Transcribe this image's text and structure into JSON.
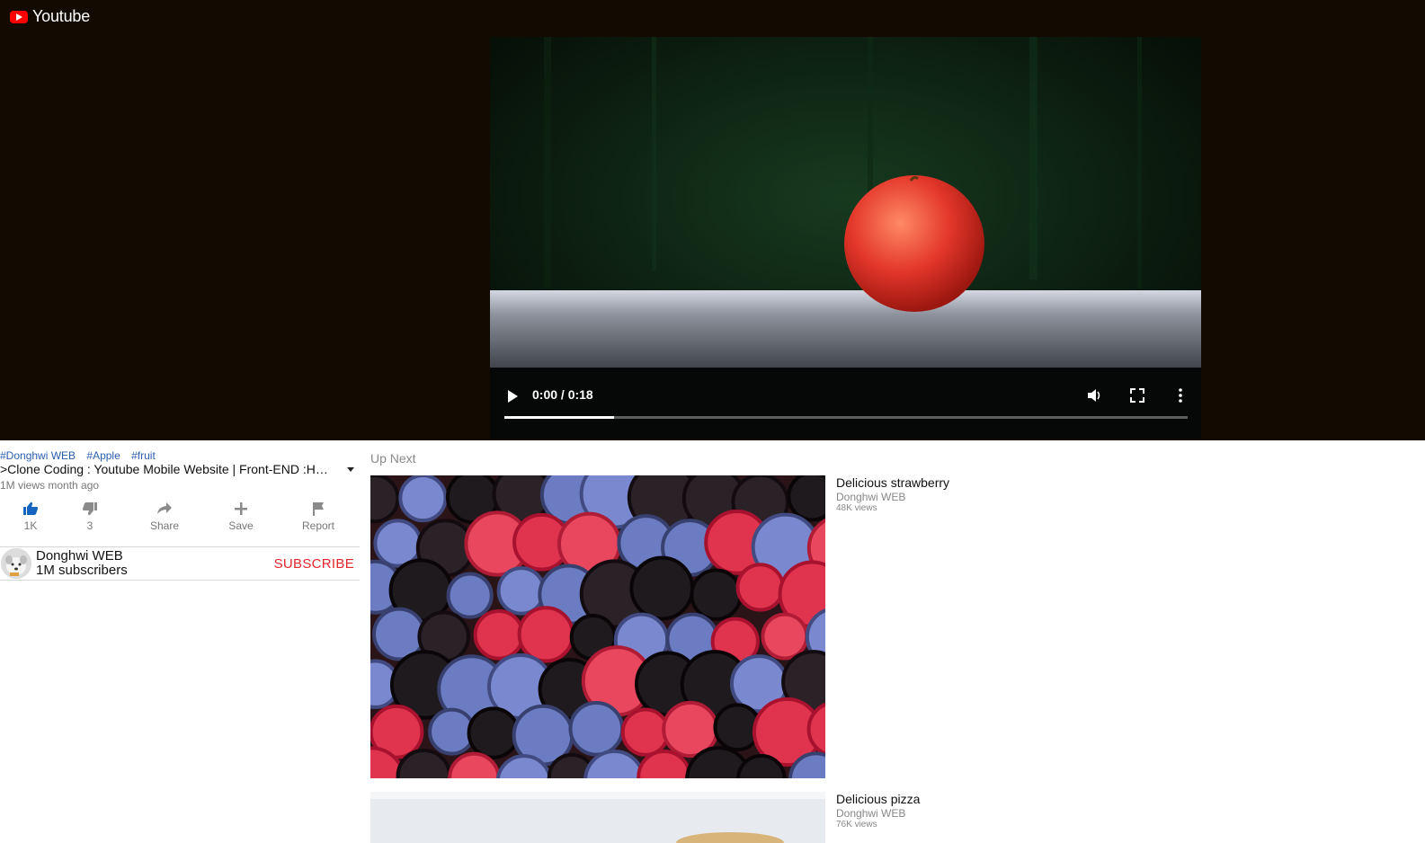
{
  "header": {
    "logo_text": "Youtube",
    "logo_icon": "youtube-play-icon"
  },
  "player": {
    "time": "0:00 / 0:18",
    "progress_fraction": 0.16,
    "icons": [
      "play-icon",
      "volume-icon",
      "fullscreen-icon",
      "more-vert-icon"
    ]
  },
  "video": {
    "tags": [
      "#Donghwi WEB",
      "#Apple",
      "#fruit"
    ],
    "title": ">Clone Coding : Youtube Mobile Website | Front-END :HTML, CSS, JS",
    "meta": "1M views month ago"
  },
  "actions": [
    {
      "label": "1K",
      "icon": "thumbs-up-icon"
    },
    {
      "label": "3",
      "icon": "thumbs-down-icon"
    },
    {
      "label": "Share",
      "icon": "share-icon"
    },
    {
      "label": "Save",
      "icon": "plus-icon"
    },
    {
      "label": "Report",
      "icon": "flag-icon"
    }
  ],
  "channel": {
    "name": "Donghwi WEB",
    "subscribers": "1M subscribers",
    "subscribe_label": "SUBSCRIBE"
  },
  "up_next": {
    "label": "Up Next",
    "items": [
      {
        "title": "Delicious strawberry",
        "channel": "Donghwi WEB",
        "views": "48K views"
      },
      {
        "title": "Delicious pizza",
        "channel": "Donghwi WEB",
        "views": "76K views"
      }
    ]
  },
  "colors": {
    "header_bg": "#130b02",
    "subscribe": "#e3262b",
    "tag": "#2a5db0",
    "accent_like": "#1565c0"
  }
}
